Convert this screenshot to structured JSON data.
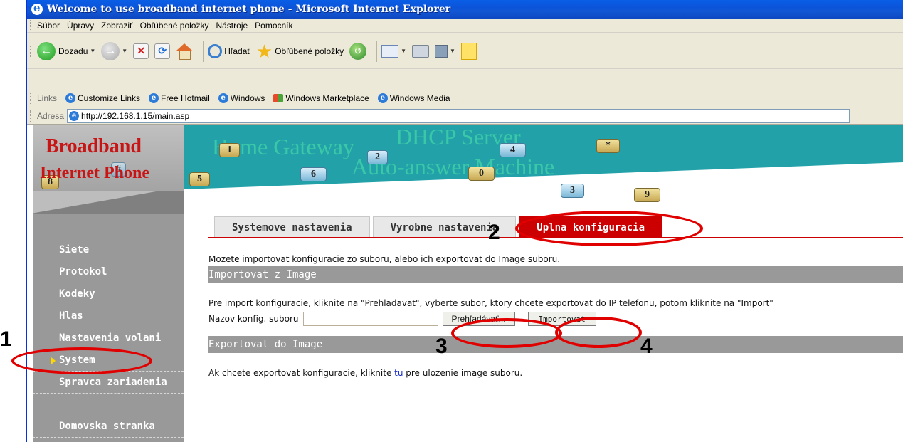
{
  "window": {
    "title": "Welcome to use broadband internet phone - Microsoft Internet Explorer"
  },
  "menubar": {
    "items": [
      "Súbor",
      "Úpravy",
      "Zobraziť",
      "Obľúbené položky",
      "Nástroje",
      "Pomocník"
    ]
  },
  "toolbar": {
    "back_label": "Dozadu",
    "search_label": "Hľadať",
    "favorites_label": "Obľúbené položky"
  },
  "links_bar": {
    "label": "Links",
    "items": [
      "Customize Links",
      "Free Hotmail",
      "Windows",
      "Windows Marketplace",
      "Windows Media"
    ]
  },
  "address_bar": {
    "label": "Adresa",
    "url": "http://192.168.1.15/main.asp"
  },
  "brand": {
    "line1": "Broadband",
    "line2": "Internet Phone"
  },
  "banner": {
    "ghost_text_1": "Home Gateway",
    "ghost_text_2": "DHCP Server",
    "ghost_text_3": "Auto-answer Machine",
    "keys": [
      "1",
      "2",
      "4",
      "*",
      "5",
      "6",
      "0",
      "3",
      "9",
      "8",
      "#"
    ]
  },
  "nav": {
    "items": [
      "Siete",
      "Protokol",
      "Kodeky",
      "Hlas",
      "Nastavenia volani",
      "System",
      "Spravca zariadenia"
    ],
    "home": "Domovska stranka"
  },
  "tabs": [
    "Systemove nastavenia",
    "Vyrobne nastavenia",
    "Uplna konfiguracia"
  ],
  "content": {
    "intro": "Mozete importovat konfiguracie zo suboru, alebo ich exportovat do Image suboru.",
    "import_header": "Importovat z Image",
    "import_text": "Pre import konfiguracie, kliknite na \"Prehladavat\", vyberte subor, ktory chcete exportovat do IP telefonu, potom kliknite na \"Import\"",
    "file_label": "Nazov konfig. suboru",
    "browse_label": "Prehľadávať...",
    "import_button": "Importovat",
    "export_header": "Exportovat do Image",
    "export_text_before": "Ak chcete exportovat konfiguracie, kliknite ",
    "export_link": "tu",
    "export_text_after": " pre ulozenie image suboru."
  },
  "annotations": [
    "1",
    "2",
    "3",
    "4"
  ],
  "colors": {
    "accent_red": "#cc0000",
    "banner_teal": "#23a1a9",
    "sidebar_grey": "#999999",
    "titlebar_blue": "#0b54da"
  }
}
